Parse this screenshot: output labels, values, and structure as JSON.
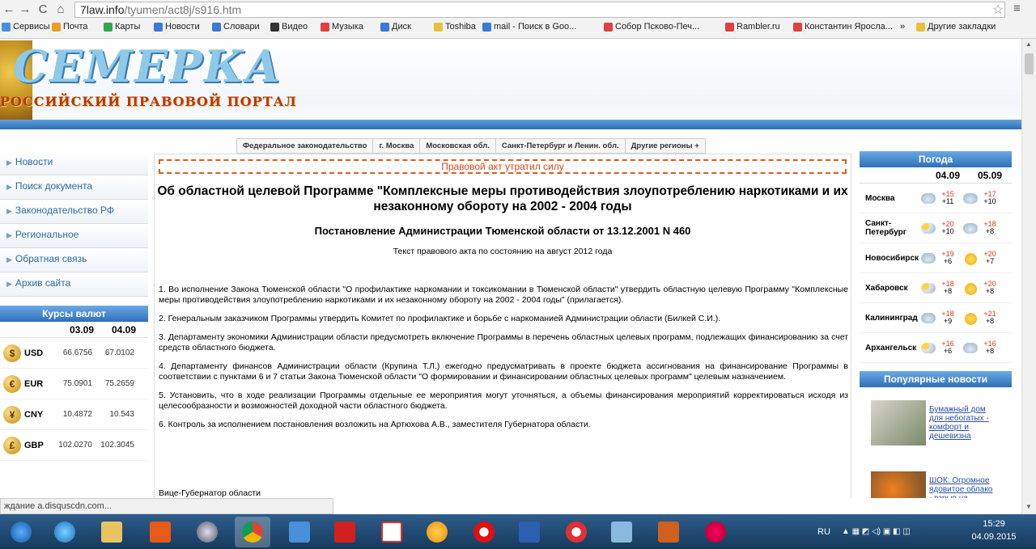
{
  "browser": {
    "url_host": "7law.info",
    "url_path": "/tyumen/act8j/s916.htm",
    "bookmarks": [
      {
        "label": "Сервисы",
        "color": "#4a90d9"
      },
      {
        "label": "Почта",
        "color": "#e8a020"
      },
      {
        "label": "Карты",
        "color": "#2fa84f"
      },
      {
        "label": "Новости",
        "color": "#3a7bd5"
      },
      {
        "label": "Словари",
        "color": "#3a7bd5"
      },
      {
        "label": "Видео",
        "color": "#333333"
      },
      {
        "label": "Музыка",
        "color": "#e04040"
      },
      {
        "label": "Диск",
        "color": "#3a7bd5"
      },
      {
        "label": "Toshiba",
        "color": "#e8c040"
      },
      {
        "label": "mail - Поиск в Goo...",
        "color": "#3a7bd5"
      },
      {
        "label": "Собор Псково-Печ...",
        "color": "#e04040"
      },
      {
        "label": "Rambler.ru",
        "color": "#e04040"
      },
      {
        "label": "Константин Яросла...",
        "color": "#e04040"
      }
    ],
    "other_bookmarks": "Другие закладки",
    "more": "»",
    "status": "ждание a.disquscdn.com..."
  },
  "site": {
    "logo_title": "СЕМЕРКА",
    "logo_subtitle": "РОССИЙСКИЙ ПРАВОВОЙ ПОРТАЛ"
  },
  "region_tabs": [
    "Федеральное законодательство",
    "г. Москва",
    "Московская обл.",
    "Санкт-Петербург и Ленин. обл.",
    "Другие регионы +"
  ],
  "left_nav": [
    "Новости",
    "Поиск документа",
    "Законодательство РФ",
    "Региональное",
    "Обратная связь",
    "Архив сайта"
  ],
  "currency": {
    "title": "Курсы валют",
    "dates": [
      "03.09",
      "04.09"
    ],
    "rows": [
      {
        "symbol": "$",
        "code": "USD",
        "v1": "66.6756",
        "v2": "67.0102"
      },
      {
        "symbol": "€",
        "code": "EUR",
        "v1": "75.0901",
        "v2": "75.2659"
      },
      {
        "symbol": "¥",
        "code": "CNY",
        "v1": "10.4872",
        "v2": "10.543"
      },
      {
        "symbol": "£",
        "code": "GBP",
        "v1": "102.0270",
        "v2": "102.3045"
      }
    ]
  },
  "document": {
    "lapsed": "Правовой акт утратил силу",
    "title": "Об областной целевой Программе \"Комплексные меры противодействия злоупотреблению наркотиками и их незаконному обороту на 2002 - 2004 годы",
    "subtitle": "Постановление Администрации Тюменской области от 13.12.2001 N 460",
    "note": "Текст правового акта по состоянию на август 2012 года",
    "paragraphs": [
      "1. Во исполнение Закона Тюменской области \"О профилактике наркомании и токсикомании в Тюменской области\" утвердить областную целевую Программу \"Комплексные меры противодействия злоупотреблению наркотиками и их незаконному обороту на 2002 - 2004 годы\" (прилагается).",
      "2. Генеральным заказчиком Программы утвердить Комитет по профилактике и борьбе с наркоманией Администрации области (Билкей С.И.).",
      "3. Департаменту экономики Администрации области предусмотреть включение Программы в перечень областных целевых программ, подлежащих финансированию за счет средств областного бюджета.",
      "4. Департаменту финансов Администрации области (Крупина Т.Л.) ежегодно предусматривать в проекте бюджета ассигнования на финансирование Программы в соответствии с пунктами 6 и 7 статьи Закона Тюменской области \"О формировании и финансировании областных целевых программ\" целевым назначением.",
      "5. Установить, что в ходе реализации Программы отдельные ее мероприятия могут уточняться, а объемы финансирования мероприятий корректироваться исходя из целесообразности и возможностей доходной части областного бюджета.",
      "6. Контроль за исполнением постановления возложить на Артюхова А.В., заместителя Губернатора области."
    ],
    "signature": "Вице-Губернатор области"
  },
  "weather": {
    "title": "Погода",
    "dates": [
      "04.09",
      "05.09"
    ],
    "rows": [
      {
        "city": "Москва",
        "i1": "cloud-icon",
        "hi1": "+15",
        "lo1": "+11",
        "i2": "cloud-icon",
        "hi2": "+17",
        "lo2": "+10"
      },
      {
        "city": "Санкт-Петербург",
        "i1": "sun-cloud-icon",
        "hi1": "+20",
        "lo1": "+10",
        "i2": "cloud-icon",
        "hi2": "+18",
        "lo2": "+8"
      },
      {
        "city": "Новосибирск",
        "i1": "cloud-icon",
        "hi1": "+19",
        "lo1": "+6",
        "i2": "sun-icon",
        "hi2": "+20",
        "lo2": "+7"
      },
      {
        "city": "Хабаровск",
        "i1": "sun-cloud-icon",
        "hi1": "+18",
        "lo1": "+8",
        "i2": "sun-icon",
        "hi2": "+20",
        "lo2": "+8"
      },
      {
        "city": "Калининград",
        "i1": "cloud-icon",
        "hi1": "+18",
        "lo1": "+9",
        "i2": "sun-icon",
        "hi2": "+21",
        "lo2": "+8"
      },
      {
        "city": "Архангельск",
        "i1": "sun-cloud-icon",
        "hi1": "+16",
        "lo1": "+6",
        "i2": "cloud-icon",
        "hi2": "+16",
        "lo2": "+8"
      }
    ]
  },
  "popular": {
    "title": "Популярные новости",
    "items": [
      {
        "text": "Бумажный дом для небогатых - комфорт и дешевизна"
      },
      {
        "text": "ШОК: Огромное ядовитое облако - взрыв на химическом заводе"
      }
    ]
  },
  "taskbar": {
    "lang": "RU",
    "time": "15:29",
    "date": "04.09.2015"
  }
}
